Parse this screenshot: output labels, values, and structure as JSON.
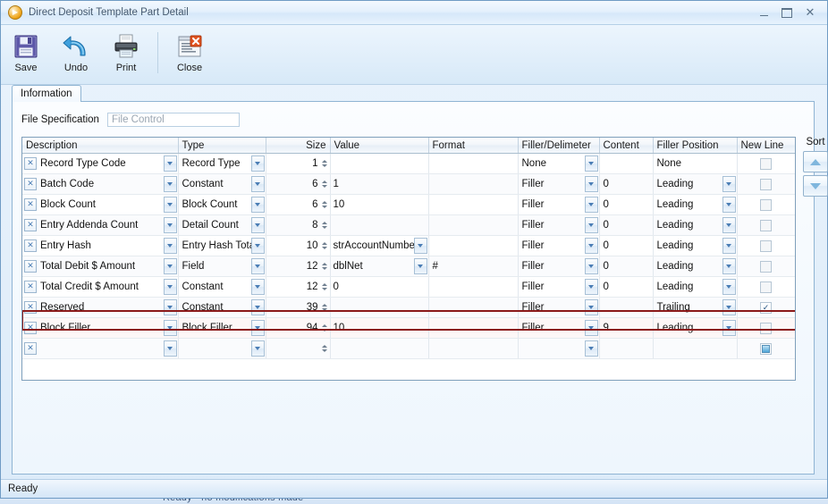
{
  "window": {
    "title": "Direct Deposit Template Part Detail",
    "app_icon": "play-circle-icon",
    "minimize_label": "–",
    "maximize_label": "□",
    "close_label": "✕"
  },
  "toolbar": {
    "items": [
      {
        "label": "Save",
        "icon": "floppy-disk-icon"
      },
      {
        "label": "Undo",
        "icon": "undo-arrow-icon"
      },
      {
        "label": "Print",
        "icon": "printer-icon"
      },
      {
        "label": "Close",
        "icon": "window-close-icon"
      }
    ]
  },
  "tabs": [
    {
      "label": "Information",
      "active": true
    }
  ],
  "file_specification": {
    "label": "File Specification",
    "value": "",
    "placeholder": "File Control"
  },
  "grid": {
    "columns": [
      {
        "key": "description",
        "label": "Description",
        "align": "left"
      },
      {
        "key": "type",
        "label": "Type",
        "align": "left"
      },
      {
        "key": "size",
        "label": "Size",
        "align": "right"
      },
      {
        "key": "value",
        "label": "Value",
        "align": "left"
      },
      {
        "key": "format",
        "label": "Format",
        "align": "left"
      },
      {
        "key": "filler",
        "label": "Filler/Delimeter",
        "align": "left"
      },
      {
        "key": "content",
        "label": "Content",
        "align": "left"
      },
      {
        "key": "position",
        "label": "Filler Position",
        "align": "left"
      },
      {
        "key": "newline",
        "label": "New Line",
        "align": "left"
      }
    ],
    "rows": [
      {
        "description": "Record Type Code",
        "type": "Record Type",
        "size": "1",
        "value": "",
        "value_dropdown": false,
        "format": "",
        "filler": "None",
        "content": "",
        "position": "None",
        "position_dropdown": false,
        "newline": "off",
        "selected": false
      },
      {
        "description": "Batch Code",
        "type": "Constant",
        "size": "6",
        "value": "1",
        "value_dropdown": false,
        "format": "",
        "filler": "Filler",
        "content": "0",
        "position": "Leading",
        "position_dropdown": true,
        "newline": "off",
        "selected": false
      },
      {
        "description": "Block Count",
        "type": "Block Count",
        "size": "6",
        "value": "10",
        "value_dropdown": false,
        "format": "",
        "filler": "Filler",
        "content": "0",
        "position": "Leading",
        "position_dropdown": true,
        "newline": "off",
        "selected": false
      },
      {
        "description": "Entry Addenda Count",
        "type": "Detail Count",
        "size": "8",
        "value": "",
        "value_dropdown": false,
        "format": "",
        "filler": "Filler",
        "content": "0",
        "position": "Leading",
        "position_dropdown": true,
        "newline": "off",
        "selected": false
      },
      {
        "description": "Entry Hash",
        "type": "Entry Hash Total",
        "size": "10",
        "value": "strAccountNumber",
        "value_dropdown": true,
        "format": "",
        "filler": "Filler",
        "content": "0",
        "position": "Leading",
        "position_dropdown": true,
        "newline": "off",
        "selected": false
      },
      {
        "description": "Total Debit $ Amount",
        "type": "Field",
        "size": "12",
        "value": "dblNet",
        "value_dropdown": true,
        "format": "#",
        "filler": "Filler",
        "content": "0",
        "position": "Leading",
        "position_dropdown": true,
        "newline": "off",
        "selected": false
      },
      {
        "description": "Total Credit $ Amount",
        "type": "Constant",
        "size": "12",
        "value": "0",
        "value_dropdown": false,
        "format": "",
        "filler": "Filler",
        "content": "0",
        "position": "Leading",
        "position_dropdown": true,
        "newline": "off",
        "selected": false
      },
      {
        "description": "Reserved",
        "type": "Constant",
        "size": "39",
        "value": "",
        "value_dropdown": false,
        "format": "",
        "filler": "Filler",
        "content": "",
        "position": "Trailing",
        "position_dropdown": true,
        "newline": "on",
        "selected": false
      },
      {
        "description": "Block Filler",
        "type": "Block Filler",
        "size": "94",
        "value": "10",
        "value_dropdown": false,
        "format": "",
        "filler": "Filler",
        "content": "9",
        "position": "Leading",
        "position_dropdown": true,
        "newline": "off",
        "selected": true
      },
      {
        "description": "",
        "type": "",
        "size": "",
        "value": "",
        "value_dropdown": false,
        "format": "",
        "filler": "",
        "content": "",
        "position": "",
        "position_dropdown": false,
        "newline": "partial",
        "selected": false,
        "is_new_row": true
      }
    ]
  },
  "sort": {
    "label": "Sort",
    "up_icon": "triangle-up-icon",
    "down_icon": "triangle-down-icon"
  },
  "statusbar": {
    "text": "Ready"
  },
  "background": {
    "text": "Ready - no modifications made"
  },
  "colors": {
    "selection_border": "#8b1a1a",
    "window_border": "#6f9bc4",
    "accent": "#4a7db5"
  }
}
